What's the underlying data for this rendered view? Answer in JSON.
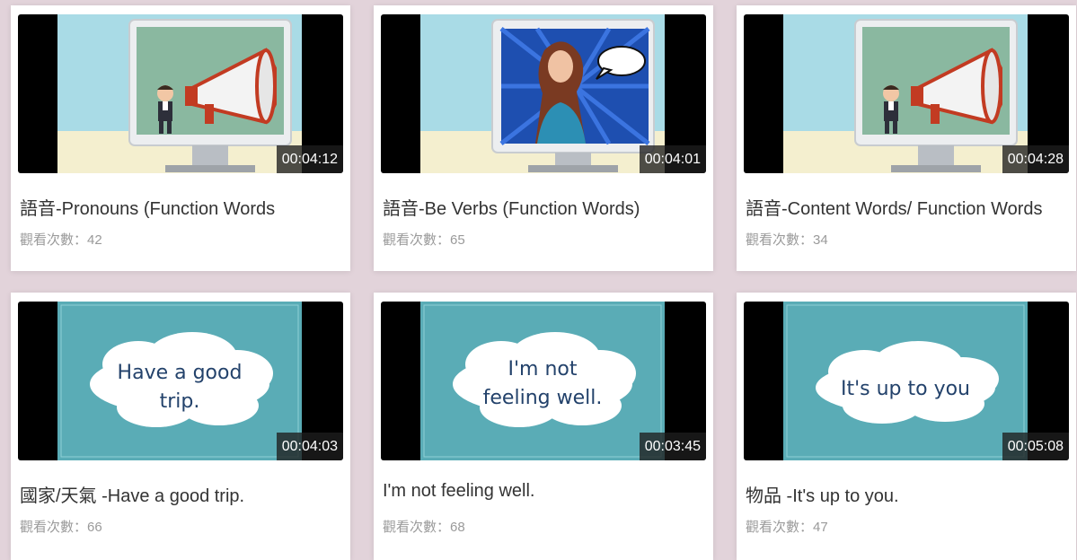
{
  "videos": [
    {
      "title": "語音-Pronouns (Function Words",
      "views": "觀看次數：42",
      "duration": "00:04:12",
      "thumb": "megaphone"
    },
    {
      "title": "語音-Be Verbs (Function Words)",
      "views": "觀看次數：65",
      "duration": "00:04:01",
      "thumb": "popart"
    },
    {
      "title": "語音-Content Words/ Function Words",
      "views": "觀看次數：34",
      "duration": "00:04:28",
      "thumb": "megaphone"
    },
    {
      "title": "國家/天氣 -Have a good trip.",
      "views": "觀看次數：66",
      "duration": "00:04:03",
      "thumb": "cloud",
      "cloud_lines": [
        "Have a good",
        "trip."
      ]
    },
    {
      "title": "I'm not feeling well.",
      "views": "觀看次數：68",
      "duration": "00:03:45",
      "thumb": "cloud",
      "cloud_lines": [
        "I'm not",
        "feeling well."
      ]
    },
    {
      "title": "物品 -It's up to you.",
      "views": "觀看次數：47",
      "duration": "00:05:08",
      "thumb": "cloud",
      "cloud_lines": [
        "It's up to you"
      ]
    }
  ],
  "colors": {
    "background": "#e2d3da",
    "slide_teal": "#5aacb6",
    "sky": "#a9dbe6",
    "screen_green": "#8ab8a0",
    "popart_blue": "#1e4fb0"
  }
}
